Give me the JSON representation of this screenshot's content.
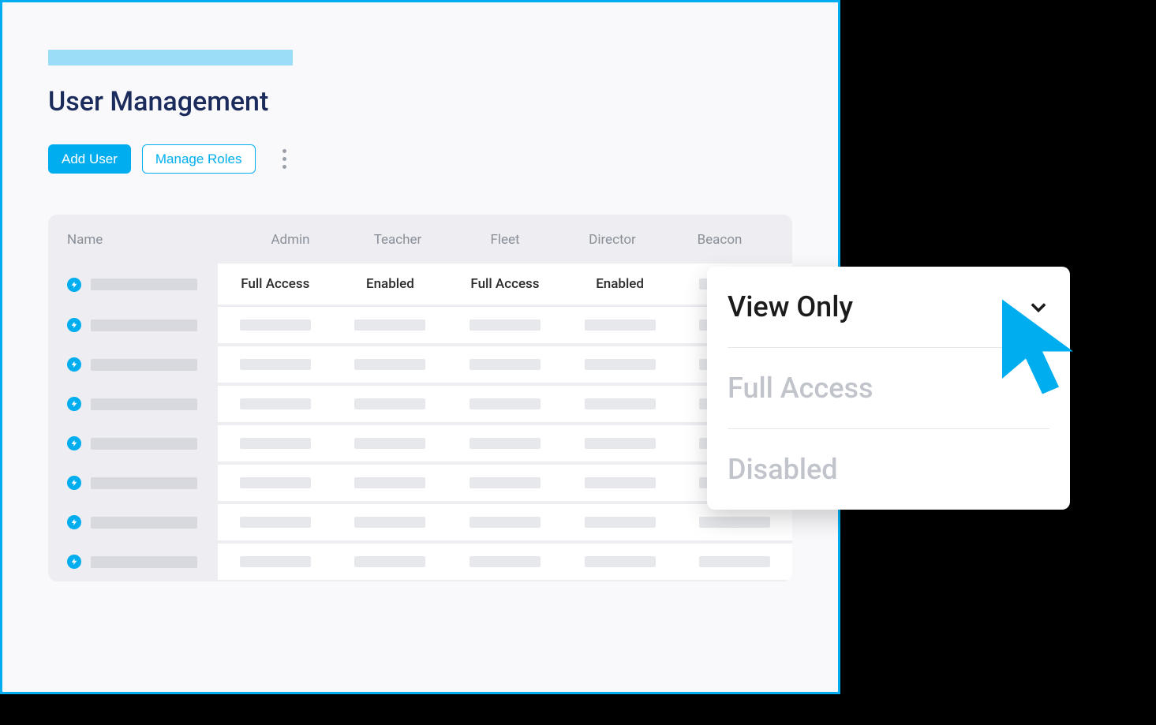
{
  "colors": {
    "accent": "#00aeef",
    "title": "#1a2b5c"
  },
  "header": {
    "title": "User Management"
  },
  "actions": {
    "add_user": "Add User",
    "manage_roles": "Manage Roles"
  },
  "table": {
    "columns": [
      "Name",
      "Admin",
      "Teacher",
      "Fleet",
      "Director",
      "Beacon"
    ],
    "rows": [
      {
        "name_placeholder": true,
        "roles": [
          "Full Access",
          "Enabled",
          "Full Access",
          "Enabled",
          null
        ]
      },
      {
        "name_placeholder": true,
        "roles": [
          null,
          null,
          null,
          null,
          null
        ]
      },
      {
        "name_placeholder": true,
        "roles": [
          null,
          null,
          null,
          null,
          null
        ]
      },
      {
        "name_placeholder": true,
        "roles": [
          null,
          null,
          null,
          null,
          null
        ]
      },
      {
        "name_placeholder": true,
        "roles": [
          null,
          null,
          null,
          null,
          null
        ]
      },
      {
        "name_placeholder": true,
        "roles": [
          null,
          null,
          null,
          null,
          null
        ]
      },
      {
        "name_placeholder": true,
        "roles": [
          null,
          null,
          null,
          null,
          null
        ]
      },
      {
        "name_placeholder": true,
        "roles": [
          null,
          null,
          null,
          null,
          null
        ]
      }
    ]
  },
  "dropdown": {
    "selected": "View Only",
    "options": [
      "View Only",
      "Full Access",
      "Disabled"
    ]
  }
}
